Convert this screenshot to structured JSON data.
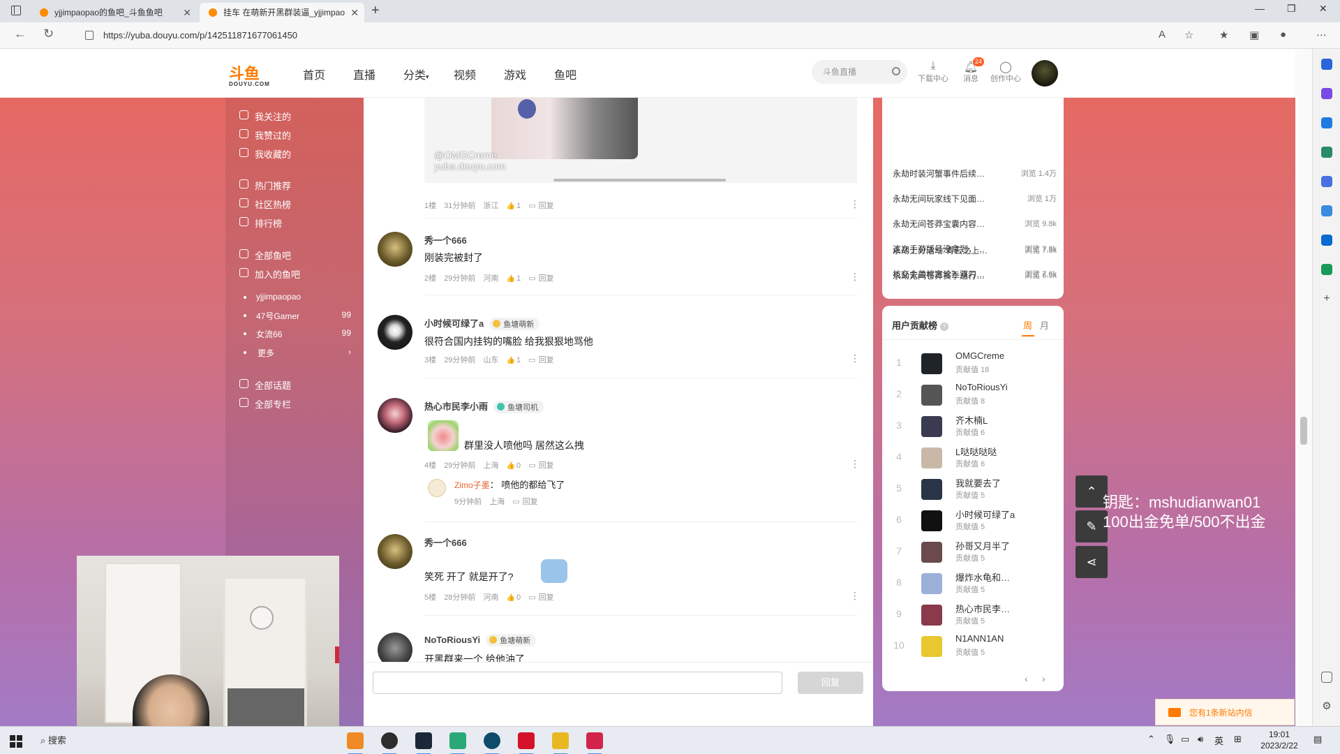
{
  "browser": {
    "tabs": [
      {
        "label": "yjjimpaopao的鱼吧_斗鱼鱼吧",
        "active": false
      },
      {
        "label": "挂车 在萌新开黑群装逼_yjjimpao",
        "active": true
      }
    ],
    "url": "https://yuba.douyu.com/p/142511871677061450"
  },
  "site": {
    "logo_main": "斗鱼",
    "logo_sub": "DOUYU.COM",
    "nav": [
      "首页",
      "直播",
      "分类",
      "视频",
      "游戏",
      "鱼吧"
    ],
    "search_placeholder": "斗鱼直播",
    "tools": [
      {
        "label": "下载中心",
        "icon": "download-icon"
      },
      {
        "label": "消息",
        "icon": "bell-icon",
        "badge": "24"
      },
      {
        "label": "创作中心",
        "icon": "bulb-icon"
      }
    ]
  },
  "leftnav": {
    "group1": [
      "我关注的",
      "我赞过的",
      "我收藏的"
    ],
    "group2": [
      "热门推荐",
      "社区热榜",
      "排行榜"
    ],
    "group3": [
      "全部鱼吧",
      "加入的鱼吧"
    ],
    "joined": [
      {
        "name": "yjjimpaopao",
        "count": ""
      },
      {
        "name": "47号Gamer",
        "count": "99"
      },
      {
        "name": "女流66",
        "count": "99"
      }
    ],
    "more": "更多",
    "group4": [
      "全部话题",
      "全部专栏"
    ]
  },
  "image_watermark": [
    "@OMGCreme",
    "yuba.douyu.com"
  ],
  "posts": [
    {
      "floor": "1楼",
      "time": "31分钟前",
      "location": "浙江",
      "likes": "1",
      "reply": "回复"
    },
    {
      "name": "秀一个666",
      "text": "刚装完被封了",
      "floor": "2楼",
      "time": "29分钟前",
      "location": "河南",
      "likes": "1",
      "reply": "回复"
    },
    {
      "name": "小时候可绿了a",
      "tag": "鱼塘萌新",
      "text": "很符合国内挂钩的嘴脸 给我狠狠地骂他",
      "floor": "3楼",
      "time": "29分钟前",
      "location": "山东",
      "likes": "1",
      "reply": "回复"
    },
    {
      "name": "热心市民李小雨",
      "tag": "鱼塘司机",
      "text": "群里没人喷他吗 居然这么拽",
      "floor": "4楼",
      "time": "29分钟前",
      "location": "上海",
      "likes": "0",
      "reply": "回复",
      "sub_reply": {
        "name": "Zimo子墨",
        "text": "喷他的都给飞了",
        "time": "9分钟前",
        "location": "上海",
        "reply": "回复"
      }
    },
    {
      "name": "秀一个666",
      "text": "笑死 开了 就是开了?",
      "floor": "5楼",
      "time": "28分钟前",
      "location": "河南",
      "likes": "0",
      "reply": "回复"
    },
    {
      "name": "NoToRiousYi",
      "tag": "鱼塘萌新",
      "text": "开黑群来一个 给他油了"
    }
  ],
  "comment": {
    "button": "回复"
  },
  "hot_list": [
    {
      "title": "永劫时装河蟹事件后续…",
      "views": "浏览 1.4万"
    },
    {
      "title": "永劫无间玩家线下见面…",
      "views": "浏览 1万"
    },
    {
      "title": "永劫无间苍莽宝囊内容…",
      "views": "浏览 9.8k"
    },
    {
      "title": "这次手游版号没拿到，…",
      "views": "浏览 7.8k"
    },
    {
      "title": "杭交会盖棺定论？双刀…",
      "views": "浏览 7.6k"
    },
    {
      "title": "永劫上分活动\"青云之上…",
      "views": "浏览 7.3k"
    },
    {
      "title": "永劫无间苍莽赛季通行…",
      "views": "浏览 6.5k"
    }
  ],
  "contrib": {
    "title": "用户贡献榜",
    "help": "?",
    "periods": [
      "周",
      "月"
    ],
    "active_period": "周",
    "rows": [
      {
        "rank": "1",
        "name": "OMGCreme",
        "value": "贡献值 18"
      },
      {
        "rank": "2",
        "name": "NoToRiousYi",
        "value": "贡献值 8"
      },
      {
        "rank": "3",
        "name": "齐木楠L",
        "value": "贡献值 6"
      },
      {
        "rank": "4",
        "name": "L哒哒哒哒",
        "value": "贡献值 6"
      },
      {
        "rank": "5",
        "name": "我就要去了",
        "value": "贡献值 5"
      },
      {
        "rank": "6",
        "name": "小时候可绿了a",
        "value": "贡献值 5"
      },
      {
        "rank": "7",
        "name": "孙哥又月半了",
        "value": "贡献值 5"
      },
      {
        "rank": "8",
        "name": "爆炸水龟和…",
        "value": "贡献值 5"
      },
      {
        "rank": "9",
        "name": "热心市民李…",
        "value": "贡献值 5"
      },
      {
        "rank": "10",
        "name": "N1ANN1AN",
        "value": "贡献值 5"
      }
    ],
    "prev": "‹",
    "next": "›"
  },
  "overlay": [
    "钥匙：mshudianwan01",
    "100出金免单/500不出金"
  ],
  "toast": "您有1条新站内信",
  "taskbar": {
    "search": "搜索",
    "tray_lang": "英",
    "time": "19:01",
    "date": "2023/2/22"
  },
  "colors": {
    "accent": "#ff7a00",
    "tag_yellow": "#f5c040",
    "tag_teal": "#3ec6b0"
  }
}
